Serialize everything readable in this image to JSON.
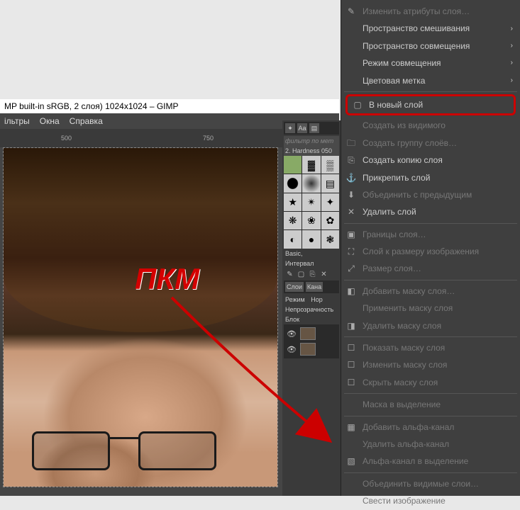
{
  "title": "MP built-in sRGB, 2 слоя) 1024x1024 – GIMP",
  "menu": {
    "filters": "ільтры",
    "windows": "Окна",
    "help": "Справка"
  },
  "ruler": {
    "t500": "500",
    "t750": "750"
  },
  "panel": {
    "filter_placeholder": "фильтр по мет",
    "hardness": "2. Hardness 050",
    "basic": "Basic,",
    "interval": "Интервал",
    "tab_layers": "Слои",
    "tab_channels": "Кана",
    "mode": "Режим",
    "mode_val": "Нор",
    "opacity": "Непрозрачность",
    "lock": "Блок"
  },
  "ctx": {
    "edit_attrs": "Изменить атрибуты слоя…",
    "blend_space": "Пространство смешивания",
    "composite_space": "Пространство совмещения",
    "composite_mode": "Режим совмещения",
    "color_tag": "Цветовая метка",
    "new_layer": "В новый слой",
    "from_visible": "Создать из видимого",
    "new_group": "Создать группу слоёв…",
    "duplicate": "Создать копию слоя",
    "anchor": "Прикрепить слой",
    "merge_down": "Объединить с предыдущим",
    "delete": "Удалить слой",
    "boundary": "Границы слоя…",
    "to_image_size": "Слой к размеру изображения",
    "layer_size": "Размер слоя…",
    "add_mask": "Добавить маску слоя…",
    "apply_mask": "Применить маску слоя",
    "delete_mask": "Удалить маску слоя",
    "show_mask": "Показать маску слоя",
    "edit_mask": "Изменить маску слоя",
    "hide_mask": "Скрыть маску слоя",
    "mask_to_sel": "Маска в выделение",
    "add_alpha": "Добавить альфа-канал",
    "remove_alpha": "Удалить альфа-канал",
    "alpha_to_sel": "Альфа-канал в выделение",
    "merge_visible": "Объединить видимые слои…",
    "flatten": "Свести изображение"
  },
  "annotation": {
    "pkm": "ПКМ"
  }
}
